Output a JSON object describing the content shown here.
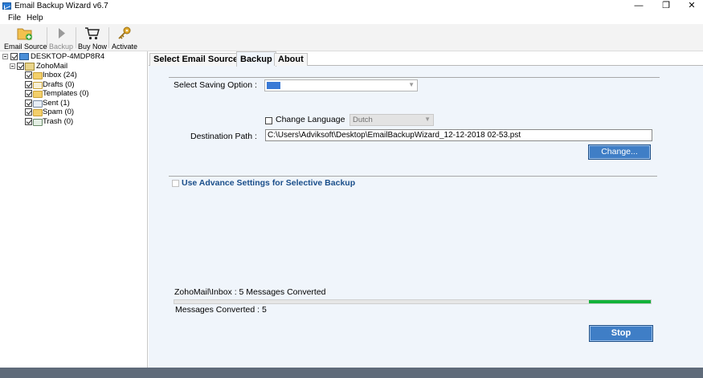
{
  "window": {
    "title": "Email Backup Wizard v6.7",
    "minimize": "—",
    "maximize": "❐",
    "close": "✕"
  },
  "menu": {
    "items": [
      "File",
      "Help"
    ]
  },
  "toolbar": {
    "email_source": "Email Source",
    "backup": "Backup",
    "buy_now": "Buy Now",
    "activate": "Activate"
  },
  "tree": {
    "root": "DESKTOP-4MDP8R4",
    "account": "ZohoMail",
    "folders": [
      "Inbox (24)",
      "Drafts (0)",
      "Templates (0)",
      "Sent (1)",
      "Spam (0)",
      "Trash (0)"
    ]
  },
  "tabs": [
    "Select Email Source",
    "Backup",
    "About"
  ],
  "backup": {
    "saving_option_label": "Select Saving Option :",
    "change_language_label": "Change Language",
    "language_value": "Dutch",
    "destination_label": "Destination Path :",
    "destination_value": "C:\\Users\\Adviksoft\\Desktop\\EmailBackupWizard_12-12-2018 02-53.pst",
    "change_button": "Change...",
    "advance_label": "Use Advance Settings for Selective Backup",
    "status_text": "ZohoMail\\Inbox : 5 Messages Converted",
    "progress_fraction": 0.13,
    "messages_converted": "Messages Converted : 5",
    "stop_button": "Stop"
  },
  "colors": {
    "accent_button": "#3f7ec6",
    "progress": "#13b23a",
    "panel_bg": "#f0f5fb",
    "link_text": "#1a4e8a"
  }
}
